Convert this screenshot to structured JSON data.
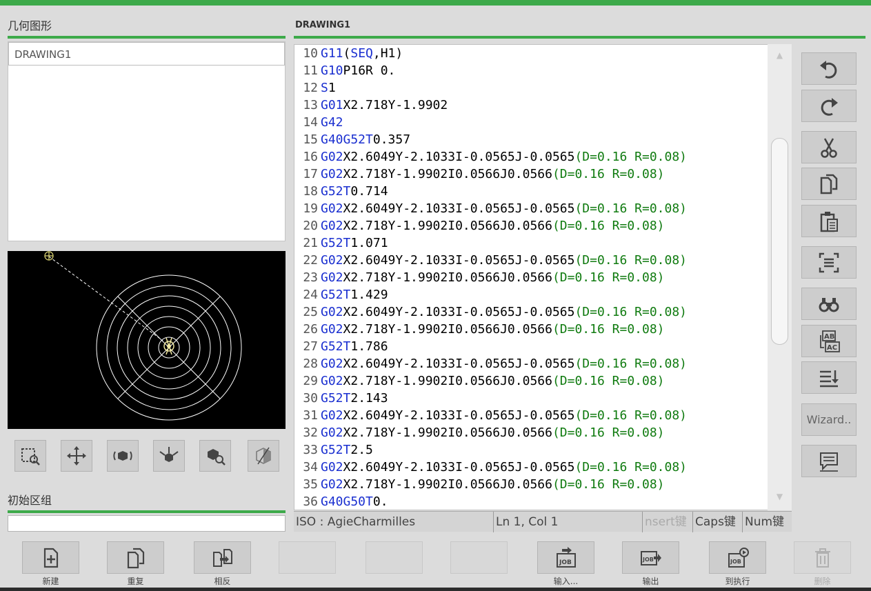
{
  "left_panel": {
    "title": "几何图形",
    "list": [
      "DRAWING1"
    ],
    "group_title": "初始区组",
    "group_input_value": ""
  },
  "editor": {
    "title": "DRAWING1",
    "lines": [
      {
        "n": "10",
        "segs": [
          [
            "k",
            "G11"
          ],
          [
            "t",
            "("
          ],
          [
            "k",
            "SEQ"
          ],
          [
            "t",
            ",H1)"
          ]
        ]
      },
      {
        "n": "11",
        "segs": [
          [
            "k",
            "G10"
          ],
          [
            "t",
            "P16R 0."
          ]
        ]
      },
      {
        "n": "12",
        "segs": [
          [
            "k",
            "S"
          ],
          [
            "t",
            "1"
          ]
        ]
      },
      {
        "n": "13",
        "segs": [
          [
            "k",
            "G01"
          ],
          [
            "t",
            "X2.718Y-1.9902"
          ]
        ]
      },
      {
        "n": "14",
        "segs": [
          [
            "k",
            "G42"
          ]
        ]
      },
      {
        "n": "15",
        "segs": [
          [
            "k",
            "G40G52T"
          ],
          [
            "t",
            "0.357"
          ]
        ]
      },
      {
        "n": "16",
        "segs": [
          [
            "k",
            "G02"
          ],
          [
            "t",
            "X2.6049Y-2.1033I-0.0565J-0.0565"
          ],
          [
            "c",
            "(D=0.16 R=0.08)"
          ]
        ]
      },
      {
        "n": "17",
        "segs": [
          [
            "k",
            "G02"
          ],
          [
            "t",
            "X2.718Y-1.9902I0.0566J0.0566"
          ],
          [
            "c",
            "(D=0.16 R=0.08)"
          ]
        ]
      },
      {
        "n": "18",
        "segs": [
          [
            "k",
            "G52T"
          ],
          [
            "t",
            "0.714"
          ]
        ]
      },
      {
        "n": "19",
        "segs": [
          [
            "k",
            "G02"
          ],
          [
            "t",
            "X2.6049Y-2.1033I-0.0565J-0.0565"
          ],
          [
            "c",
            "(D=0.16 R=0.08)"
          ]
        ]
      },
      {
        "n": "20",
        "segs": [
          [
            "k",
            "G02"
          ],
          [
            "t",
            "X2.718Y-1.9902I0.0566J0.0566"
          ],
          [
            "c",
            "(D=0.16 R=0.08)"
          ]
        ]
      },
      {
        "n": "21",
        "segs": [
          [
            "k",
            "G52T"
          ],
          [
            "t",
            "1.071"
          ]
        ]
      },
      {
        "n": "22",
        "segs": [
          [
            "k",
            "G02"
          ],
          [
            "t",
            "X2.6049Y-2.1033I-0.0565J-0.0565"
          ],
          [
            "c",
            "(D=0.16 R=0.08)"
          ]
        ]
      },
      {
        "n": "23",
        "segs": [
          [
            "k",
            "G02"
          ],
          [
            "t",
            "X2.718Y-1.9902I0.0566J0.0566"
          ],
          [
            "c",
            "(D=0.16 R=0.08)"
          ]
        ]
      },
      {
        "n": "24",
        "segs": [
          [
            "k",
            "G52T"
          ],
          [
            "t",
            "1.429"
          ]
        ]
      },
      {
        "n": "25",
        "segs": [
          [
            "k",
            "G02"
          ],
          [
            "t",
            "X2.6049Y-2.1033I-0.0565J-0.0565"
          ],
          [
            "c",
            "(D=0.16 R=0.08)"
          ]
        ]
      },
      {
        "n": "26",
        "segs": [
          [
            "k",
            "G02"
          ],
          [
            "t",
            "X2.718Y-1.9902I0.0566J0.0566"
          ],
          [
            "c",
            "(D=0.16 R=0.08)"
          ]
        ]
      },
      {
        "n": "27",
        "segs": [
          [
            "k",
            "G52T"
          ],
          [
            "t",
            "1.786"
          ]
        ]
      },
      {
        "n": "28",
        "segs": [
          [
            "k",
            "G02"
          ],
          [
            "t",
            "X2.6049Y-2.1033I-0.0565J-0.0565"
          ],
          [
            "c",
            "(D=0.16 R=0.08)"
          ]
        ]
      },
      {
        "n": "29",
        "segs": [
          [
            "k",
            "G02"
          ],
          [
            "t",
            "X2.718Y-1.9902I0.0566J0.0566"
          ],
          [
            "c",
            "(D=0.16 R=0.08)"
          ]
        ]
      },
      {
        "n": "30",
        "segs": [
          [
            "k",
            "G52T"
          ],
          [
            "t",
            "2.143"
          ]
        ]
      },
      {
        "n": "31",
        "segs": [
          [
            "k",
            "G02"
          ],
          [
            "t",
            "X2.6049Y-2.1033I-0.0565J-0.0565"
          ],
          [
            "c",
            "(D=0.16 R=0.08)"
          ]
        ]
      },
      {
        "n": "32",
        "segs": [
          [
            "k",
            "G02"
          ],
          [
            "t",
            "X2.718Y-1.9902I0.0566J0.0566"
          ],
          [
            "c",
            "(D=0.16 R=0.08)"
          ]
        ]
      },
      {
        "n": "33",
        "segs": [
          [
            "k",
            "G52T"
          ],
          [
            "t",
            "2.5"
          ]
        ]
      },
      {
        "n": "34",
        "segs": [
          [
            "k",
            "G02"
          ],
          [
            "t",
            "X2.6049Y-2.1033I-0.0565J-0.0565"
          ],
          [
            "c",
            "(D=0.16 R=0.08)"
          ]
        ]
      },
      {
        "n": "35",
        "segs": [
          [
            "k",
            "G02"
          ],
          [
            "t",
            "X2.718Y-1.9902I0.0566J0.0566"
          ],
          [
            "c",
            "(D=0.16 R=0.08)"
          ]
        ]
      },
      {
        "n": "36",
        "segs": [
          [
            "k",
            "G40G50T"
          ],
          [
            "t",
            "0."
          ]
        ]
      }
    ]
  },
  "status": {
    "language": "ISO : AgieCharmilles",
    "position": "Ln 1, Col 1",
    "insert": "nsert键",
    "caps": "Caps键",
    "num": "Num键"
  },
  "view_tools": [
    "zoom-window-icon",
    "pan-icon",
    "rotate-3d-icon",
    "axes-3d-icon",
    "zoom-object-icon",
    "view-cube-icon"
  ],
  "side_tools": {
    "icons": [
      "undo-icon",
      "redo-icon",
      "cut-icon",
      "copy-icon",
      "paste-icon",
      "select-all-icon",
      "find-icon",
      "replace-icon",
      "sort-icon",
      "comment-icon"
    ],
    "wizard_label": "Wizard.."
  },
  "bottom_toolbar": {
    "new_label": "新建",
    "duplicate_label": "重复",
    "reverse_label": "相反",
    "import_label": "输入...",
    "export_label": "输出",
    "execute_label": "到执行",
    "delete_label": "删除"
  },
  "colors": {
    "accent": "#3daa4a",
    "keyword": "#1a2fd0",
    "comment": "#107b10",
    "text": "#000000"
  }
}
